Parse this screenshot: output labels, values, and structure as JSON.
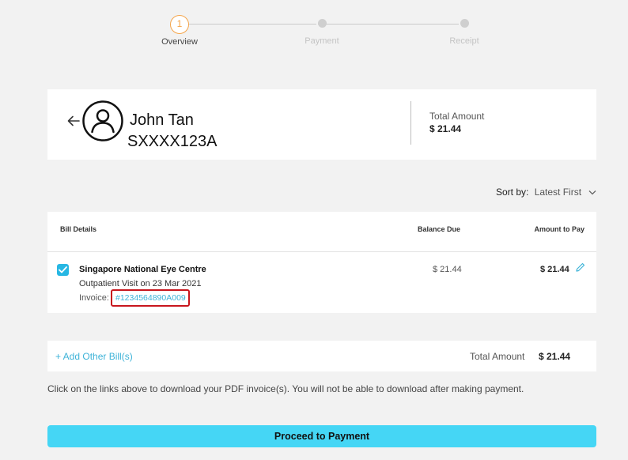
{
  "stepper": {
    "steps": [
      {
        "number": "1",
        "label": "Overview"
      },
      {
        "label": "Payment"
      },
      {
        "label": "Receipt"
      }
    ]
  },
  "patient": {
    "name": "John Tan",
    "id": "SXXXX123A",
    "total_label": "Total Amount",
    "total_value": "$ 21.44"
  },
  "sort": {
    "label": "Sort by:",
    "value": "Latest First"
  },
  "bills": {
    "headers": {
      "details": "Bill Details",
      "balance": "Balance Due",
      "amount": "Amount to Pay"
    },
    "rows": [
      {
        "checked": true,
        "provider": "Singapore National Eye Centre",
        "visit": "Outpatient Visit on 23 Mar 2021",
        "invoice_label": "Invoice:",
        "invoice_number": "#1234564890A009",
        "balance_due": "$ 21.44",
        "amount_to_pay": "$ 21.44"
      }
    ]
  },
  "add_bill": {
    "label": "+ Add Other Bill(s)",
    "total_label": "Total Amount",
    "total_value": "$ 21.44"
  },
  "note": "Click on the links above to download your PDF invoice(s). You will not be able to download after making payment.",
  "proceed_label": "Proceed to Payment",
  "colors": {
    "accent": "#45d6f5",
    "link": "#3eb3d8",
    "checkbox": "#27b7e3",
    "step_active": "#f5a54a",
    "highlight_border": "#c8161d"
  }
}
